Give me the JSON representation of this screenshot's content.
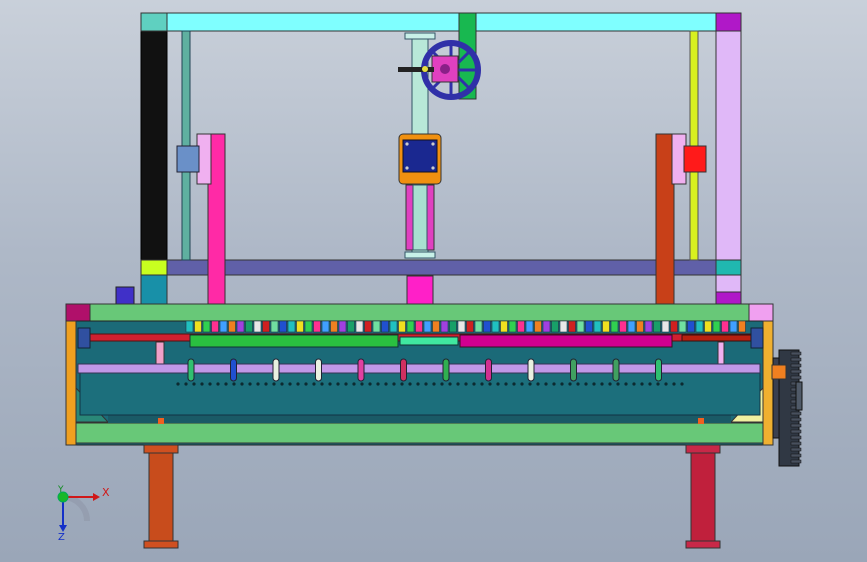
{
  "view": {
    "background_top": "#c9d0da",
    "background_bottom": "#9aa6b8"
  },
  "triad": {
    "x_label": "X",
    "y_label": "Y",
    "z_label": "Z",
    "x_color": "#d01818",
    "y_color": "#0f8a1f",
    "z_color": "#1430c8"
  },
  "colors": {
    "frame_top": "#7fffff",
    "frame_crossbar": "#6060a8",
    "left_post": "#111111",
    "right_post": "#e0b8f8",
    "machine_bed": "#1b6a78",
    "bed_base": "#68c878",
    "legs": "#c84c1c",
    "pink_rod": "#ff2aa6",
    "red_bar": "#c84018",
    "spindle_block": "#f09010",
    "green_rod": "#2ac040",
    "magenta_rod": "#d00090"
  }
}
